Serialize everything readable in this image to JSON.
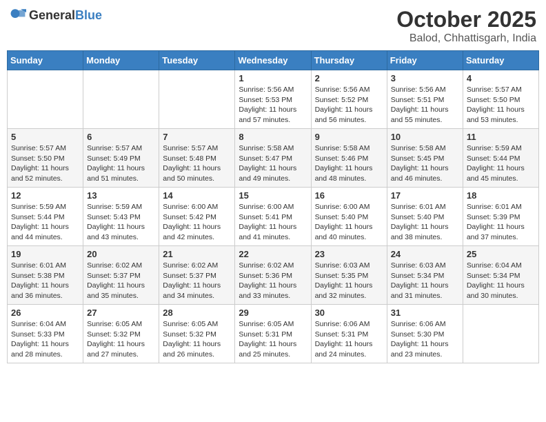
{
  "header": {
    "logo_general": "General",
    "logo_blue": "Blue",
    "month": "October 2025",
    "location": "Balod, Chhattisgarh, India"
  },
  "weekdays": [
    "Sunday",
    "Monday",
    "Tuesday",
    "Wednesday",
    "Thursday",
    "Friday",
    "Saturday"
  ],
  "weeks": [
    [
      {
        "day": "",
        "sunrise": "",
        "sunset": "",
        "daylight": ""
      },
      {
        "day": "",
        "sunrise": "",
        "sunset": "",
        "daylight": ""
      },
      {
        "day": "",
        "sunrise": "",
        "sunset": "",
        "daylight": ""
      },
      {
        "day": "1",
        "sunrise": "Sunrise: 5:56 AM",
        "sunset": "Sunset: 5:53 PM",
        "daylight": "Daylight: 11 hours and 57 minutes."
      },
      {
        "day": "2",
        "sunrise": "Sunrise: 5:56 AM",
        "sunset": "Sunset: 5:52 PM",
        "daylight": "Daylight: 11 hours and 56 minutes."
      },
      {
        "day": "3",
        "sunrise": "Sunrise: 5:56 AM",
        "sunset": "Sunset: 5:51 PM",
        "daylight": "Daylight: 11 hours and 55 minutes."
      },
      {
        "day": "4",
        "sunrise": "Sunrise: 5:57 AM",
        "sunset": "Sunset: 5:50 PM",
        "daylight": "Daylight: 11 hours and 53 minutes."
      }
    ],
    [
      {
        "day": "5",
        "sunrise": "Sunrise: 5:57 AM",
        "sunset": "Sunset: 5:50 PM",
        "daylight": "Daylight: 11 hours and 52 minutes."
      },
      {
        "day": "6",
        "sunrise": "Sunrise: 5:57 AM",
        "sunset": "Sunset: 5:49 PM",
        "daylight": "Daylight: 11 hours and 51 minutes."
      },
      {
        "day": "7",
        "sunrise": "Sunrise: 5:57 AM",
        "sunset": "Sunset: 5:48 PM",
        "daylight": "Daylight: 11 hours and 50 minutes."
      },
      {
        "day": "8",
        "sunrise": "Sunrise: 5:58 AM",
        "sunset": "Sunset: 5:47 PM",
        "daylight": "Daylight: 11 hours and 49 minutes."
      },
      {
        "day": "9",
        "sunrise": "Sunrise: 5:58 AM",
        "sunset": "Sunset: 5:46 PM",
        "daylight": "Daylight: 11 hours and 48 minutes."
      },
      {
        "day": "10",
        "sunrise": "Sunrise: 5:58 AM",
        "sunset": "Sunset: 5:45 PM",
        "daylight": "Daylight: 11 hours and 46 minutes."
      },
      {
        "day": "11",
        "sunrise": "Sunrise: 5:59 AM",
        "sunset": "Sunset: 5:44 PM",
        "daylight": "Daylight: 11 hours and 45 minutes."
      }
    ],
    [
      {
        "day": "12",
        "sunrise": "Sunrise: 5:59 AM",
        "sunset": "Sunset: 5:44 PM",
        "daylight": "Daylight: 11 hours and 44 minutes."
      },
      {
        "day": "13",
        "sunrise": "Sunrise: 5:59 AM",
        "sunset": "Sunset: 5:43 PM",
        "daylight": "Daylight: 11 hours and 43 minutes."
      },
      {
        "day": "14",
        "sunrise": "Sunrise: 6:00 AM",
        "sunset": "Sunset: 5:42 PM",
        "daylight": "Daylight: 11 hours and 42 minutes."
      },
      {
        "day": "15",
        "sunrise": "Sunrise: 6:00 AM",
        "sunset": "Sunset: 5:41 PM",
        "daylight": "Daylight: 11 hours and 41 minutes."
      },
      {
        "day": "16",
        "sunrise": "Sunrise: 6:00 AM",
        "sunset": "Sunset: 5:40 PM",
        "daylight": "Daylight: 11 hours and 40 minutes."
      },
      {
        "day": "17",
        "sunrise": "Sunrise: 6:01 AM",
        "sunset": "Sunset: 5:40 PM",
        "daylight": "Daylight: 11 hours and 38 minutes."
      },
      {
        "day": "18",
        "sunrise": "Sunrise: 6:01 AM",
        "sunset": "Sunset: 5:39 PM",
        "daylight": "Daylight: 11 hours and 37 minutes."
      }
    ],
    [
      {
        "day": "19",
        "sunrise": "Sunrise: 6:01 AM",
        "sunset": "Sunset: 5:38 PM",
        "daylight": "Daylight: 11 hours and 36 minutes."
      },
      {
        "day": "20",
        "sunrise": "Sunrise: 6:02 AM",
        "sunset": "Sunset: 5:37 PM",
        "daylight": "Daylight: 11 hours and 35 minutes."
      },
      {
        "day": "21",
        "sunrise": "Sunrise: 6:02 AM",
        "sunset": "Sunset: 5:37 PM",
        "daylight": "Daylight: 11 hours and 34 minutes."
      },
      {
        "day": "22",
        "sunrise": "Sunrise: 6:02 AM",
        "sunset": "Sunset: 5:36 PM",
        "daylight": "Daylight: 11 hours and 33 minutes."
      },
      {
        "day": "23",
        "sunrise": "Sunrise: 6:03 AM",
        "sunset": "Sunset: 5:35 PM",
        "daylight": "Daylight: 11 hours and 32 minutes."
      },
      {
        "day": "24",
        "sunrise": "Sunrise: 6:03 AM",
        "sunset": "Sunset: 5:34 PM",
        "daylight": "Daylight: 11 hours and 31 minutes."
      },
      {
        "day": "25",
        "sunrise": "Sunrise: 6:04 AM",
        "sunset": "Sunset: 5:34 PM",
        "daylight": "Daylight: 11 hours and 30 minutes."
      }
    ],
    [
      {
        "day": "26",
        "sunrise": "Sunrise: 6:04 AM",
        "sunset": "Sunset: 5:33 PM",
        "daylight": "Daylight: 11 hours and 28 minutes."
      },
      {
        "day": "27",
        "sunrise": "Sunrise: 6:05 AM",
        "sunset": "Sunset: 5:32 PM",
        "daylight": "Daylight: 11 hours and 27 minutes."
      },
      {
        "day": "28",
        "sunrise": "Sunrise: 6:05 AM",
        "sunset": "Sunset: 5:32 PM",
        "daylight": "Daylight: 11 hours and 26 minutes."
      },
      {
        "day": "29",
        "sunrise": "Sunrise: 6:05 AM",
        "sunset": "Sunset: 5:31 PM",
        "daylight": "Daylight: 11 hours and 25 minutes."
      },
      {
        "day": "30",
        "sunrise": "Sunrise: 6:06 AM",
        "sunset": "Sunset: 5:31 PM",
        "daylight": "Daylight: 11 hours and 24 minutes."
      },
      {
        "day": "31",
        "sunrise": "Sunrise: 6:06 AM",
        "sunset": "Sunset: 5:30 PM",
        "daylight": "Daylight: 11 hours and 23 minutes."
      },
      {
        "day": "",
        "sunrise": "",
        "sunset": "",
        "daylight": ""
      }
    ]
  ]
}
